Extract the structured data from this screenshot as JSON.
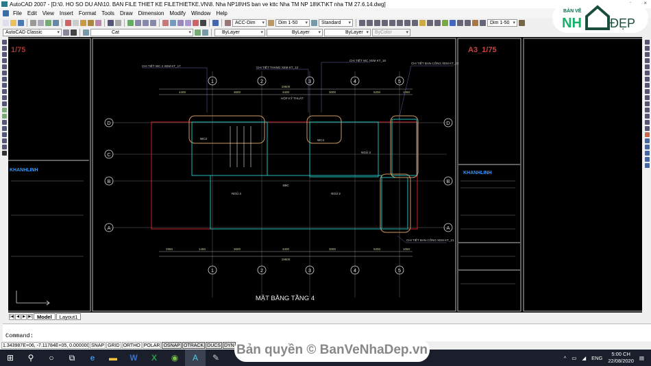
{
  "window": {
    "title": "AutoCAD 2007 - [D:\\0. HO SO DU AN\\10. BAN FILE THIET KE FILETHIETKE.VN\\8. Nha NP18\\HS ban ve kttc Nha TM NP 18\\KT\\KT nha TM 27.6.14.dwg]",
    "min": "–",
    "max": "▫",
    "close": "×"
  },
  "menu": [
    "File",
    "Edit",
    "View",
    "Insert",
    "Format",
    "Tools",
    "Draw",
    "Dimension",
    "Modify",
    "Window",
    "Help"
  ],
  "toolbar": {
    "dimstyle": "ACC-Dim",
    "dimscale": "Dim  1-50",
    "textstyle": "Standard",
    "dimstyle2": "Dim  1-50",
    "workspace": "AutoCAD Classic",
    "layer": "Cat",
    "color": "ByLayer",
    "linetype": "ByLayer",
    "lineweight": "ByLayer",
    "plotstyle": "ByColor"
  },
  "logo": {
    "top": "BẢN VẼ",
    "main": "NH",
    "suffix": "ĐẸP"
  },
  "drawing": {
    "sheet_left_label": "1/75",
    "sheet_right_label": "A3_1/75",
    "plan_title": "MẶT BẰNG TẦNG 4",
    "grid_cols": [
      "1",
      "2",
      "3",
      "4",
      "5"
    ],
    "grid_rows": [
      "D",
      "C",
      "B",
      "A"
    ],
    "callouts": [
      "CHI TIẾT WC 2 XEM KT_17",
      "CHI TIẾT THANG XEM KT_13",
      "CHI TIẾT WC XEM KT_18",
      "CHI TIẾT BAN CÔNG XEM KT_22",
      "CHI TIẾT BAN CÔNG XEM KT_21",
      "HỘP KỸ THUẬT"
    ],
    "rooms": [
      "WC2",
      "WC4",
      "NGỦ 3",
      "NGỦ 4",
      "NGỦ 2",
      "SBC"
    ],
    "dims_top": [
      "4400",
      "3600",
      "3400",
      "3000",
      "5200",
      "1050"
    ],
    "dims_total": "19600",
    "dims_bottom": [
      "2950",
      "1450",
      "3600",
      "3400",
      "3000",
      "5200",
      "1050"
    ],
    "titleblock_brand": "KHANHLINH"
  },
  "tabs": {
    "model": "Model",
    "layout1": "Layout1"
  },
  "command": {
    "prompt": "Command:"
  },
  "status": {
    "coords": "1.343987E+06, -7.11784E+05, 0.00000000",
    "toggles": [
      "SNAP",
      "GRID",
      "ORTHO",
      "POLAR",
      "OSNAP",
      "OTRACK",
      "DUCS",
      "DYN"
    ]
  },
  "watermark": "Bản quyền © BanVeNhaDep.vn",
  "tray": {
    "lang": "ENG",
    "time": "5:00 CH",
    "date": "22/08/2020"
  }
}
